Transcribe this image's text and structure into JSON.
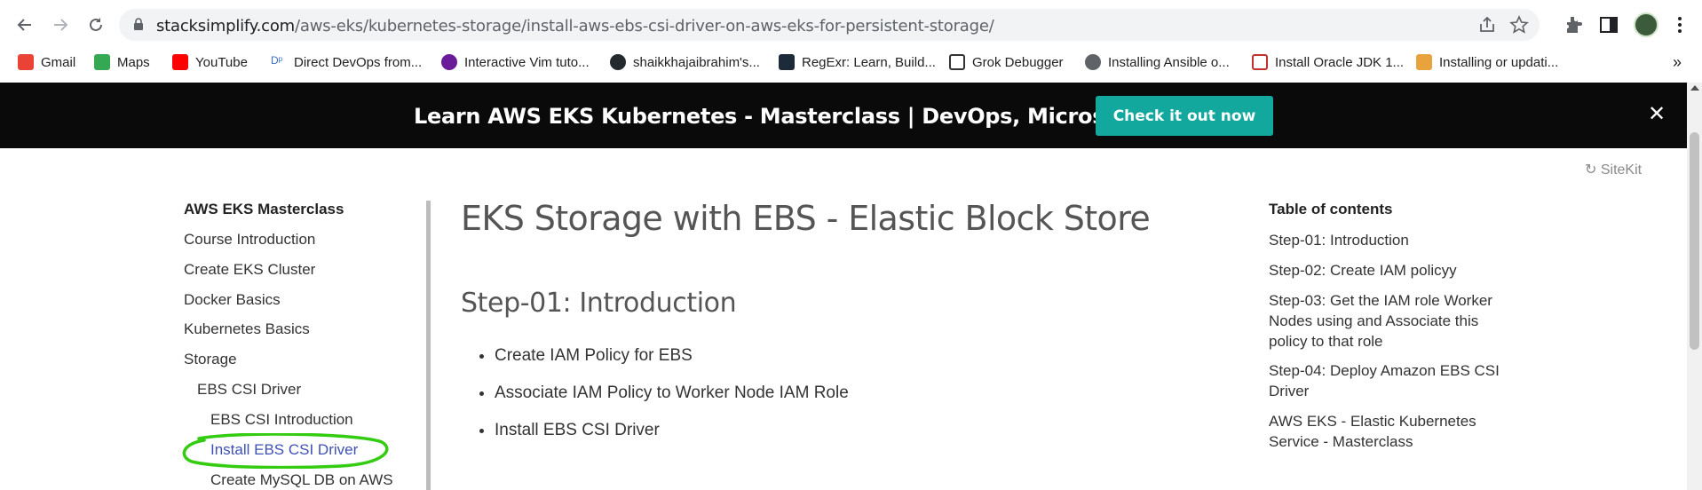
{
  "browser": {
    "url_host": "stacksimplify.com",
    "url_path": "/aws-eks/kubernetes-storage/install-aws-ebs-csi-driver-on-aws-eks-for-persistent-storage/"
  },
  "bookmarks": [
    {
      "label": "Gmail",
      "icon": "gmail-icon",
      "color": "#ea4335"
    },
    {
      "label": "Maps",
      "icon": "maps-icon",
      "color": "#34a853"
    },
    {
      "label": "YouTube",
      "icon": "youtube-icon",
      "color": "#ff0000"
    },
    {
      "label": "Direct DevOps from...",
      "icon": "devops-icon",
      "color": "#3d6fd1"
    },
    {
      "label": "Interactive Vim tuto...",
      "icon": "vim-icon",
      "color": "#6a1b9a"
    },
    {
      "label": "shaikkhajaibrahim's...",
      "icon": "github-icon",
      "color": "#24292e"
    },
    {
      "label": "RegExr: Learn, Build...",
      "icon": "regexr-icon",
      "color": "#1d2a3a"
    },
    {
      "label": "Grok Debugger",
      "icon": "grok-icon",
      "color": "#333333"
    },
    {
      "label": "Installing Ansible o...",
      "icon": "globe-icon",
      "color": "#5f6368"
    },
    {
      "label": "Install Oracle JDK 1...",
      "icon": "java-icon",
      "color": "#c4302b"
    },
    {
      "label": "Installing or updati...",
      "icon": "aws-docs-icon",
      "color": "#e8a33d"
    }
  ],
  "banner": {
    "text": "Learn AWS EKS Kubernetes - Masterclass | DevOps, Microservices",
    "cta": "Check it out now"
  },
  "sitekit": "SiteKit",
  "left_nav": {
    "title": "AWS EKS Masterclass",
    "items": [
      {
        "label": "Course Introduction",
        "level": 0
      },
      {
        "label": "Create EKS Cluster",
        "level": 0
      },
      {
        "label": "Docker Basics",
        "level": 0
      },
      {
        "label": "Kubernetes Basics",
        "level": 0
      },
      {
        "label": "Storage",
        "level": 0
      },
      {
        "label": "EBS CSI Driver",
        "level": 1
      },
      {
        "label": "EBS CSI Introduction",
        "level": 2
      },
      {
        "label": "Install EBS CSI Driver",
        "level": 2,
        "active": true
      },
      {
        "label": "Create MySQL DB on AWS",
        "level": 2
      }
    ]
  },
  "main": {
    "title": "EKS Storage with EBS - Elastic Block Store",
    "section_title": "Step-01: Introduction",
    "bullets": [
      "Create IAM Policy for EBS",
      "Associate IAM Policy to Worker Node IAM Role",
      "Install EBS CSI Driver"
    ]
  },
  "toc": {
    "title": "Table of contents",
    "items": [
      "Step-01: Introduction",
      "Step-02: Create IAM policyy",
      "Step-03: Get the IAM role Worker Nodes using and Associate this policy to that role",
      "Step-04: Deploy Amazon EBS CSI Driver",
      "AWS EKS - Elastic Kubernetes Service - Masterclass"
    ]
  },
  "colors": {
    "accent": "#13a89e",
    "active_link": "#3f51b5",
    "highlight": "#33cc11"
  }
}
